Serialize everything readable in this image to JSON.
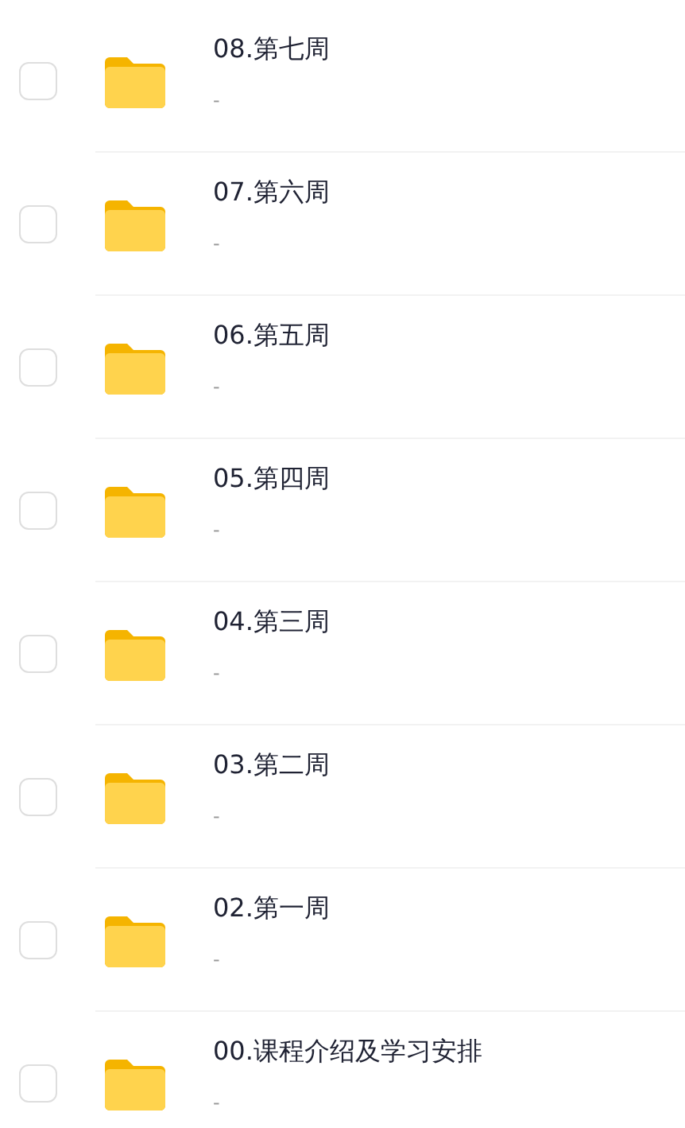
{
  "folders": [
    {
      "title": "08.第七周",
      "subtitle": "-",
      "checked": false
    },
    {
      "title": "07.第六周",
      "subtitle": "-",
      "checked": false
    },
    {
      "title": "06.第五周",
      "subtitle": "-",
      "checked": false
    },
    {
      "title": "05.第四周",
      "subtitle": "-",
      "checked": false
    },
    {
      "title": "04.第三周",
      "subtitle": "-",
      "checked": false
    },
    {
      "title": "03.第二周",
      "subtitle": "-",
      "checked": false
    },
    {
      "title": "02.第一周",
      "subtitle": "-",
      "checked": false
    },
    {
      "title": "00.课程介绍及学习安排",
      "subtitle": "-",
      "checked": false
    }
  ]
}
